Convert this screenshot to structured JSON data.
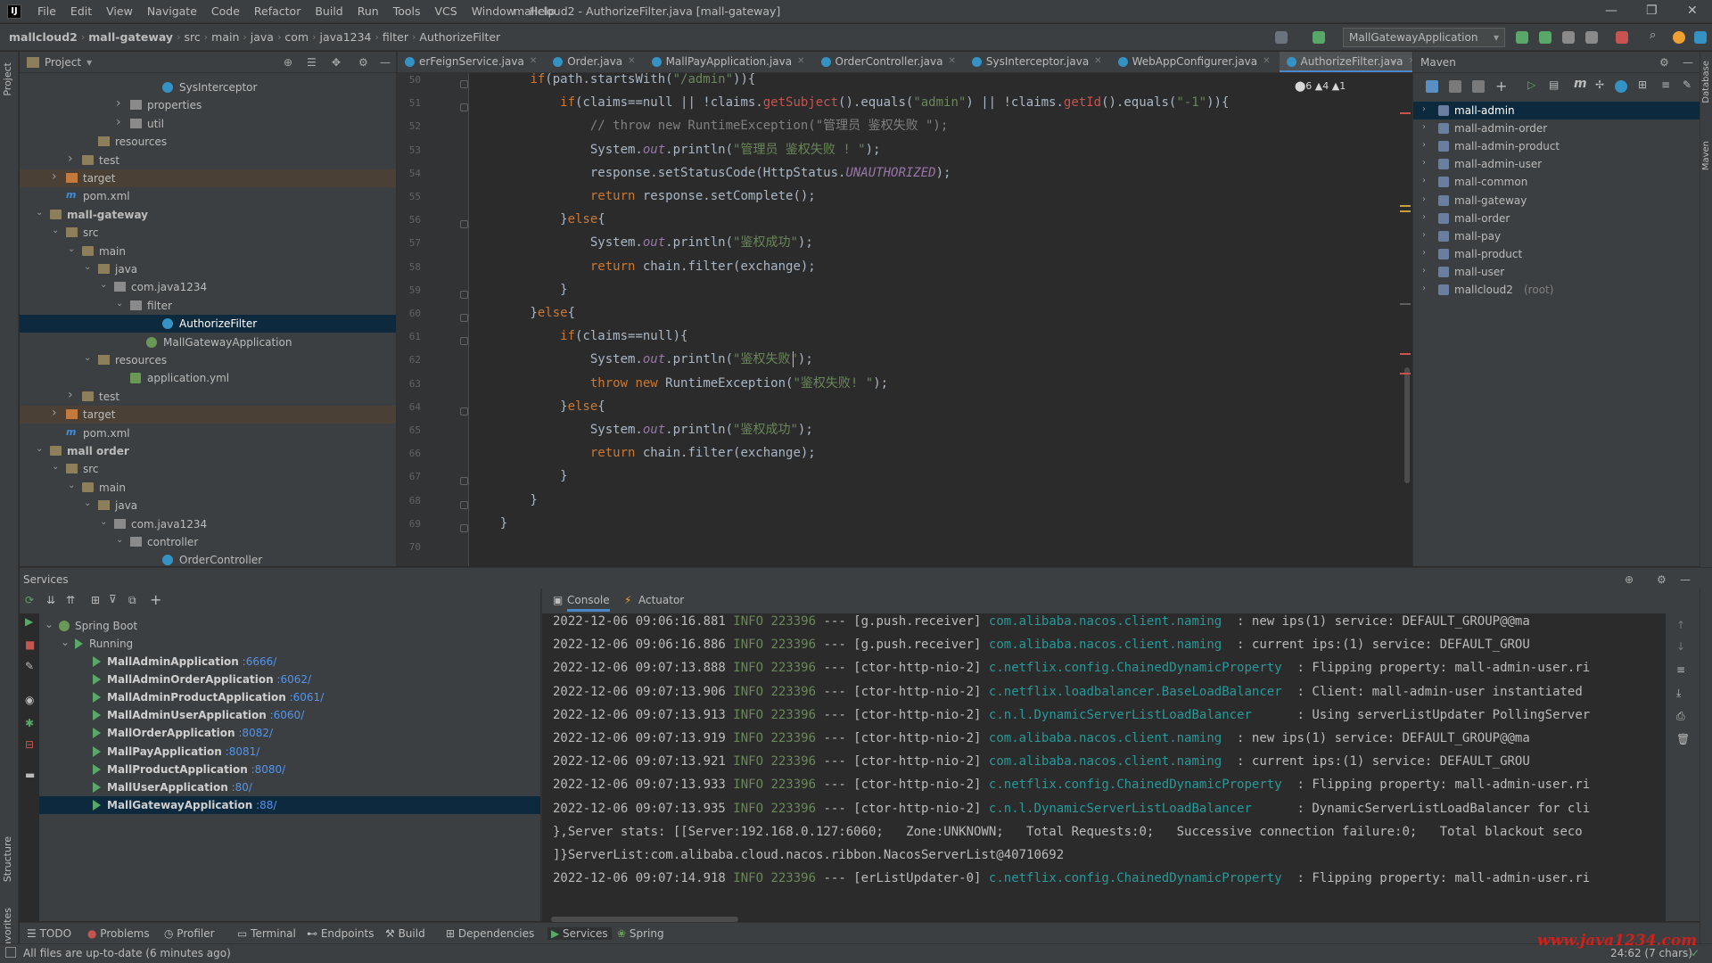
{
  "window": {
    "title": "mallcloud2 - AuthorizeFilter.java [mall-gateway]",
    "menus": [
      "File",
      "Edit",
      "View",
      "Navigate",
      "Code",
      "Refactor",
      "Build",
      "Run",
      "Tools",
      "VCS",
      "Window",
      "Help"
    ]
  },
  "breadcrumb": [
    "mallcloud2",
    "mall-gateway",
    "src",
    "main",
    "java",
    "com",
    "java1234",
    "filter",
    "AuthorizeFilter"
  ],
  "run_config": "MallGatewayApplication",
  "project_panel": {
    "title": "Project",
    "items": [
      {
        "label": "SysInterceptor",
        "indent": 8,
        "icon": "cls",
        "arrow": ""
      },
      {
        "label": "properties",
        "indent": 6,
        "icon": "folder-pkg",
        "arrow": ">"
      },
      {
        "label": "util",
        "indent": 6,
        "icon": "folder-pkg",
        "arrow": ">"
      },
      {
        "label": "resources",
        "indent": 4,
        "icon": "folder-res",
        "arrow": ""
      },
      {
        "label": "test",
        "indent": 3,
        "icon": "folder",
        "arrow": ">"
      },
      {
        "label": "target",
        "indent": 2,
        "icon": "folder-tgt",
        "arrow": ">",
        "excluded": true
      },
      {
        "label": "pom.xml",
        "indent": 2,
        "icon": "xml",
        "arrow": ""
      },
      {
        "label": "mall-gateway",
        "indent": 1,
        "icon": "folder",
        "arrow": "v",
        "bold": true
      },
      {
        "label": "src",
        "indent": 2,
        "icon": "folder-src",
        "arrow": "v"
      },
      {
        "label": "main",
        "indent": 3,
        "icon": "folder",
        "arrow": "v"
      },
      {
        "label": "java",
        "indent": 4,
        "icon": "folder-src",
        "arrow": "v"
      },
      {
        "label": "com.java1234",
        "indent": 5,
        "icon": "folder-pkg",
        "arrow": "v"
      },
      {
        "label": "filter",
        "indent": 6,
        "icon": "folder-pkg",
        "arrow": "v"
      },
      {
        "label": "AuthorizeFilter",
        "indent": 8,
        "icon": "cls",
        "arrow": "",
        "selected": true
      },
      {
        "label": "MallGatewayApplication",
        "indent": 7,
        "icon": "boot",
        "arrow": ""
      },
      {
        "label": "resources",
        "indent": 4,
        "icon": "folder-res",
        "arrow": "v"
      },
      {
        "label": "application.yml",
        "indent": 6,
        "icon": "yml",
        "arrow": ""
      },
      {
        "label": "test",
        "indent": 3,
        "icon": "folder",
        "arrow": ">"
      },
      {
        "label": "target",
        "indent": 2,
        "icon": "folder-tgt",
        "arrow": ">",
        "excluded": true
      },
      {
        "label": "pom.xml",
        "indent": 2,
        "icon": "xml",
        "arrow": ""
      },
      {
        "label": "mall order",
        "indent": 1,
        "icon": "folder",
        "arrow": "v",
        "bold": true
      },
      {
        "label": "src",
        "indent": 2,
        "icon": "folder-src",
        "arrow": "v"
      },
      {
        "label": "main",
        "indent": 3,
        "icon": "folder",
        "arrow": "v"
      },
      {
        "label": "java",
        "indent": 4,
        "icon": "folder-src",
        "arrow": "v"
      },
      {
        "label": "com.java1234",
        "indent": 5,
        "icon": "folder-pkg",
        "arrow": "v"
      },
      {
        "label": "controller",
        "indent": 6,
        "icon": "folder-pkg",
        "arrow": "v"
      },
      {
        "label": "OrderController",
        "indent": 8,
        "icon": "cls",
        "arrow": ""
      }
    ]
  },
  "editor": {
    "tabs": [
      {
        "label": "erFeignService.java",
        "active": false
      },
      {
        "label": "Order.java",
        "active": false
      },
      {
        "label": "MallPayApplication.java",
        "active": false
      },
      {
        "label": "OrderController.java",
        "active": false
      },
      {
        "label": "SysInterceptor.java",
        "active": false
      },
      {
        "label": "WebAppConfigurer.java",
        "active": false
      },
      {
        "label": "AuthorizeFilter.java",
        "active": true
      }
    ],
    "inspections": "⬤6  ▲4  ▲1",
    "line_numbers": [
      "50",
      "51",
      "52",
      "53",
      "54",
      "55",
      "56",
      "57",
      "58",
      "59",
      "60",
      "61",
      "62",
      "63",
      "64",
      "65",
      "66",
      "67",
      "68",
      "69",
      "70"
    ],
    "lines": [
      "        if(path.startsWith(\"/admin\")){",
      "            if(claims==null || !claims.getSubject().equals(\"admin\") || !claims.getId().equals(\"-1\")){",
      "                // throw new RuntimeException(\"管理员 鉴权失败 \");",
      "                System.out.println(\"管理员 鉴权失败 ! \");",
      "                response.setStatusCode(HttpStatus.UNAUTHORIZED);",
      "                return response.setComplete();",
      "            }else{",
      "                System.out.println(\"鉴权成功\");",
      "                return chain.filter(exchange);",
      "            }",
      "        }else{",
      "            if(claims==null){",
      "                System.out.println(\"鉴权失败\");",
      "                throw new RuntimeException(\"鉴权失败! \");",
      "            }else{",
      "                System.out.println(\"鉴权成功\");",
      "                return chain.filter(exchange);",
      "            }",
      "        }",
      "    }",
      ""
    ]
  },
  "maven": {
    "title": "Maven",
    "items": [
      {
        "label": "mall-admin",
        "selected": true
      },
      {
        "label": "mall-admin-order"
      },
      {
        "label": "mall-admin-product"
      },
      {
        "label": "mall-admin-user"
      },
      {
        "label": "mall-common"
      },
      {
        "label": "mall-gateway"
      },
      {
        "label": "mall-order"
      },
      {
        "label": "mall-pay"
      },
      {
        "label": "mall-product"
      },
      {
        "label": "mall-user"
      },
      {
        "label": "mallcloud2",
        "suffix": "(root)"
      }
    ]
  },
  "services": {
    "title": "Services",
    "root": "Spring Boot",
    "group": "Running",
    "apps": [
      {
        "name": "MallAdminApplication",
        "port": ":6666/"
      },
      {
        "name": "MallAdminOrderApplication",
        "port": ":6062/"
      },
      {
        "name": "MallAdminProductApplication",
        "port": ":6061/"
      },
      {
        "name": "MallAdminUserApplication",
        "port": ":6060/"
      },
      {
        "name": "MallOrderApplication",
        "port": ":8082/"
      },
      {
        "name": "MallPayApplication",
        "port": ":8081/"
      },
      {
        "name": "MallProductApplication",
        "port": ":8080/"
      },
      {
        "name": "MallUserApplication",
        "port": ":80/"
      },
      {
        "name": "MallGatewayApplication",
        "port": ":88/",
        "selected": true
      }
    ],
    "console_tabs": [
      "Console",
      "Actuator"
    ],
    "log_lines": [
      {
        "ts": "2022-12-06 09:06:16.881",
        "lvl": "INFO",
        "pid": "223396",
        "thr": "--- [g.push.receiver]",
        "cls": "com.alibaba.nacos.client.naming",
        "msg": "  : new ips(1) service: DEFAULT_GROUP@@ma"
      },
      {
        "ts": "2022-12-06 09:06:16.886",
        "lvl": "INFO",
        "pid": "223396",
        "thr": "--- [g.push.receiver]",
        "cls": "com.alibaba.nacos.client.naming",
        "msg": "  : current ips:(1) service: DEFAULT_GROU"
      },
      {
        "ts": "2022-12-06 09:07:13.888",
        "lvl": "INFO",
        "pid": "223396",
        "thr": "--- [ctor-http-nio-2]",
        "cls": "c.netflix.config.ChainedDynamicProperty",
        "msg": "  : Flipping property: mall-admin-user.ri"
      },
      {
        "ts": "2022-12-06 09:07:13.906",
        "lvl": "INFO",
        "pid": "223396",
        "thr": "--- [ctor-http-nio-2]",
        "cls": "c.netflix.loadbalancer.BaseLoadBalancer",
        "msg": "  : Client: mall-admin-user instantiated"
      },
      {
        "ts": "2022-12-06 09:07:13.913",
        "lvl": "INFO",
        "pid": "223396",
        "thr": "--- [ctor-http-nio-2]",
        "cls": "c.n.l.DynamicServerListLoadBalancer",
        "msg": "      : Using serverListUpdater PollingServer"
      },
      {
        "ts": "2022-12-06 09:07:13.919",
        "lvl": "INFO",
        "pid": "223396",
        "thr": "--- [ctor-http-nio-2]",
        "cls": "com.alibaba.nacos.client.naming",
        "msg": "  : new ips(1) service: DEFAULT_GROUP@@ma"
      },
      {
        "ts": "2022-12-06 09:07:13.921",
        "lvl": "INFO",
        "pid": "223396",
        "thr": "--- [ctor-http-nio-2]",
        "cls": "com.alibaba.nacos.client.naming",
        "msg": "  : current ips:(1) service: DEFAULT_GROU"
      },
      {
        "ts": "2022-12-06 09:07:13.933",
        "lvl": "INFO",
        "pid": "223396",
        "thr": "--- [ctor-http-nio-2]",
        "cls": "c.netflix.config.ChainedDynamicProperty",
        "msg": "  : Flipping property: mall-admin-user.ri"
      },
      {
        "ts": "2022-12-06 09:07:13.935",
        "lvl": "INFO",
        "pid": "223396",
        "thr": "--- [ctor-http-nio-2]",
        "cls": "c.n.l.DynamicServerListLoadBalancer",
        "msg": "      : DynamicServerListLoadBalancer for cli"
      }
    ],
    "raw_lines": [
      "},Server stats: [[Server:192.168.0.127:6060;   Zone:UNKNOWN;   Total Requests:0;   Successive connection failure:0;   Total blackout seco",
      "]}ServerList:com.alibaba.cloud.nacos.ribbon.NacosServerList@40710692"
    ],
    "last_log": {
      "ts": "2022-12-06 09:07:14.918",
      "lvl": "INFO",
      "pid": "223396",
      "thr": "--- [erListUpdater-0]",
      "cls": "c.netflix.config.ChainedDynamicProperty",
      "msg": "  : Flipping property: mall-admin-user.ri"
    }
  },
  "tool_windows": [
    "TODO",
    "Problems",
    "Profiler",
    "Terminal",
    "Endpoints",
    "Build",
    "Dependencies",
    "Services",
    "Spring"
  ],
  "status": {
    "message": "All files are up-to-date (6 minutes ago)",
    "position": "24:62 (7 chars)",
    "watermark": "www.java1234.com"
  },
  "colors": {
    "accent": "#4a88c7",
    "selection": "#0d293e",
    "run_green": "#59a869"
  }
}
